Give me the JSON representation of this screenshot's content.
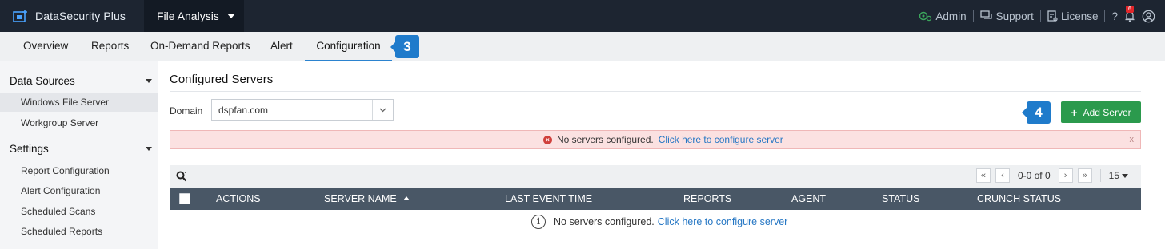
{
  "header": {
    "brand": "DataSecurity Plus",
    "product": "File Analysis",
    "admin_label": "Admin",
    "support_label": "Support",
    "license_label": "License",
    "help_label": "?",
    "notification_count": "6"
  },
  "nav": {
    "tabs": [
      "Overview",
      "Reports",
      "On-Demand Reports",
      "Alert",
      "Configuration"
    ],
    "active_tab": "Configuration",
    "step_badge": "3"
  },
  "sidebar": {
    "data_sources": {
      "heading": "Data Sources",
      "items": [
        "Windows File Server",
        "Workgroup Server"
      ],
      "selected": "Windows File Server"
    },
    "settings": {
      "heading": "Settings",
      "items": [
        "Report Configuration",
        "Alert Configuration",
        "Scheduled Scans",
        "Scheduled Reports"
      ]
    }
  },
  "main": {
    "title": "Configured Servers",
    "domain_label": "Domain",
    "domain_value": "dspfan.com",
    "step_badge": "4",
    "add_server_label": "Add Server",
    "alert": {
      "message": "No servers configured.",
      "link": "Click here to configure server",
      "close": "x"
    },
    "pager": {
      "range": "0-0 of 0",
      "page_size": "15"
    },
    "table": {
      "columns": [
        "ACTIONS",
        "SERVER NAME",
        "LAST EVENT TIME",
        "REPORTS",
        "AGENT",
        "STATUS",
        "CRUNCH STATUS"
      ],
      "sorted_column": "SERVER NAME",
      "empty_message": "No servers configured.",
      "empty_link": "Click here to configure server"
    }
  },
  "colors": {
    "topbar": "#1d2531",
    "accent": "#2b83cf",
    "add_button": "#2b9a4d",
    "table_header": "#495766",
    "alert_bg": "#fbe1e1"
  }
}
